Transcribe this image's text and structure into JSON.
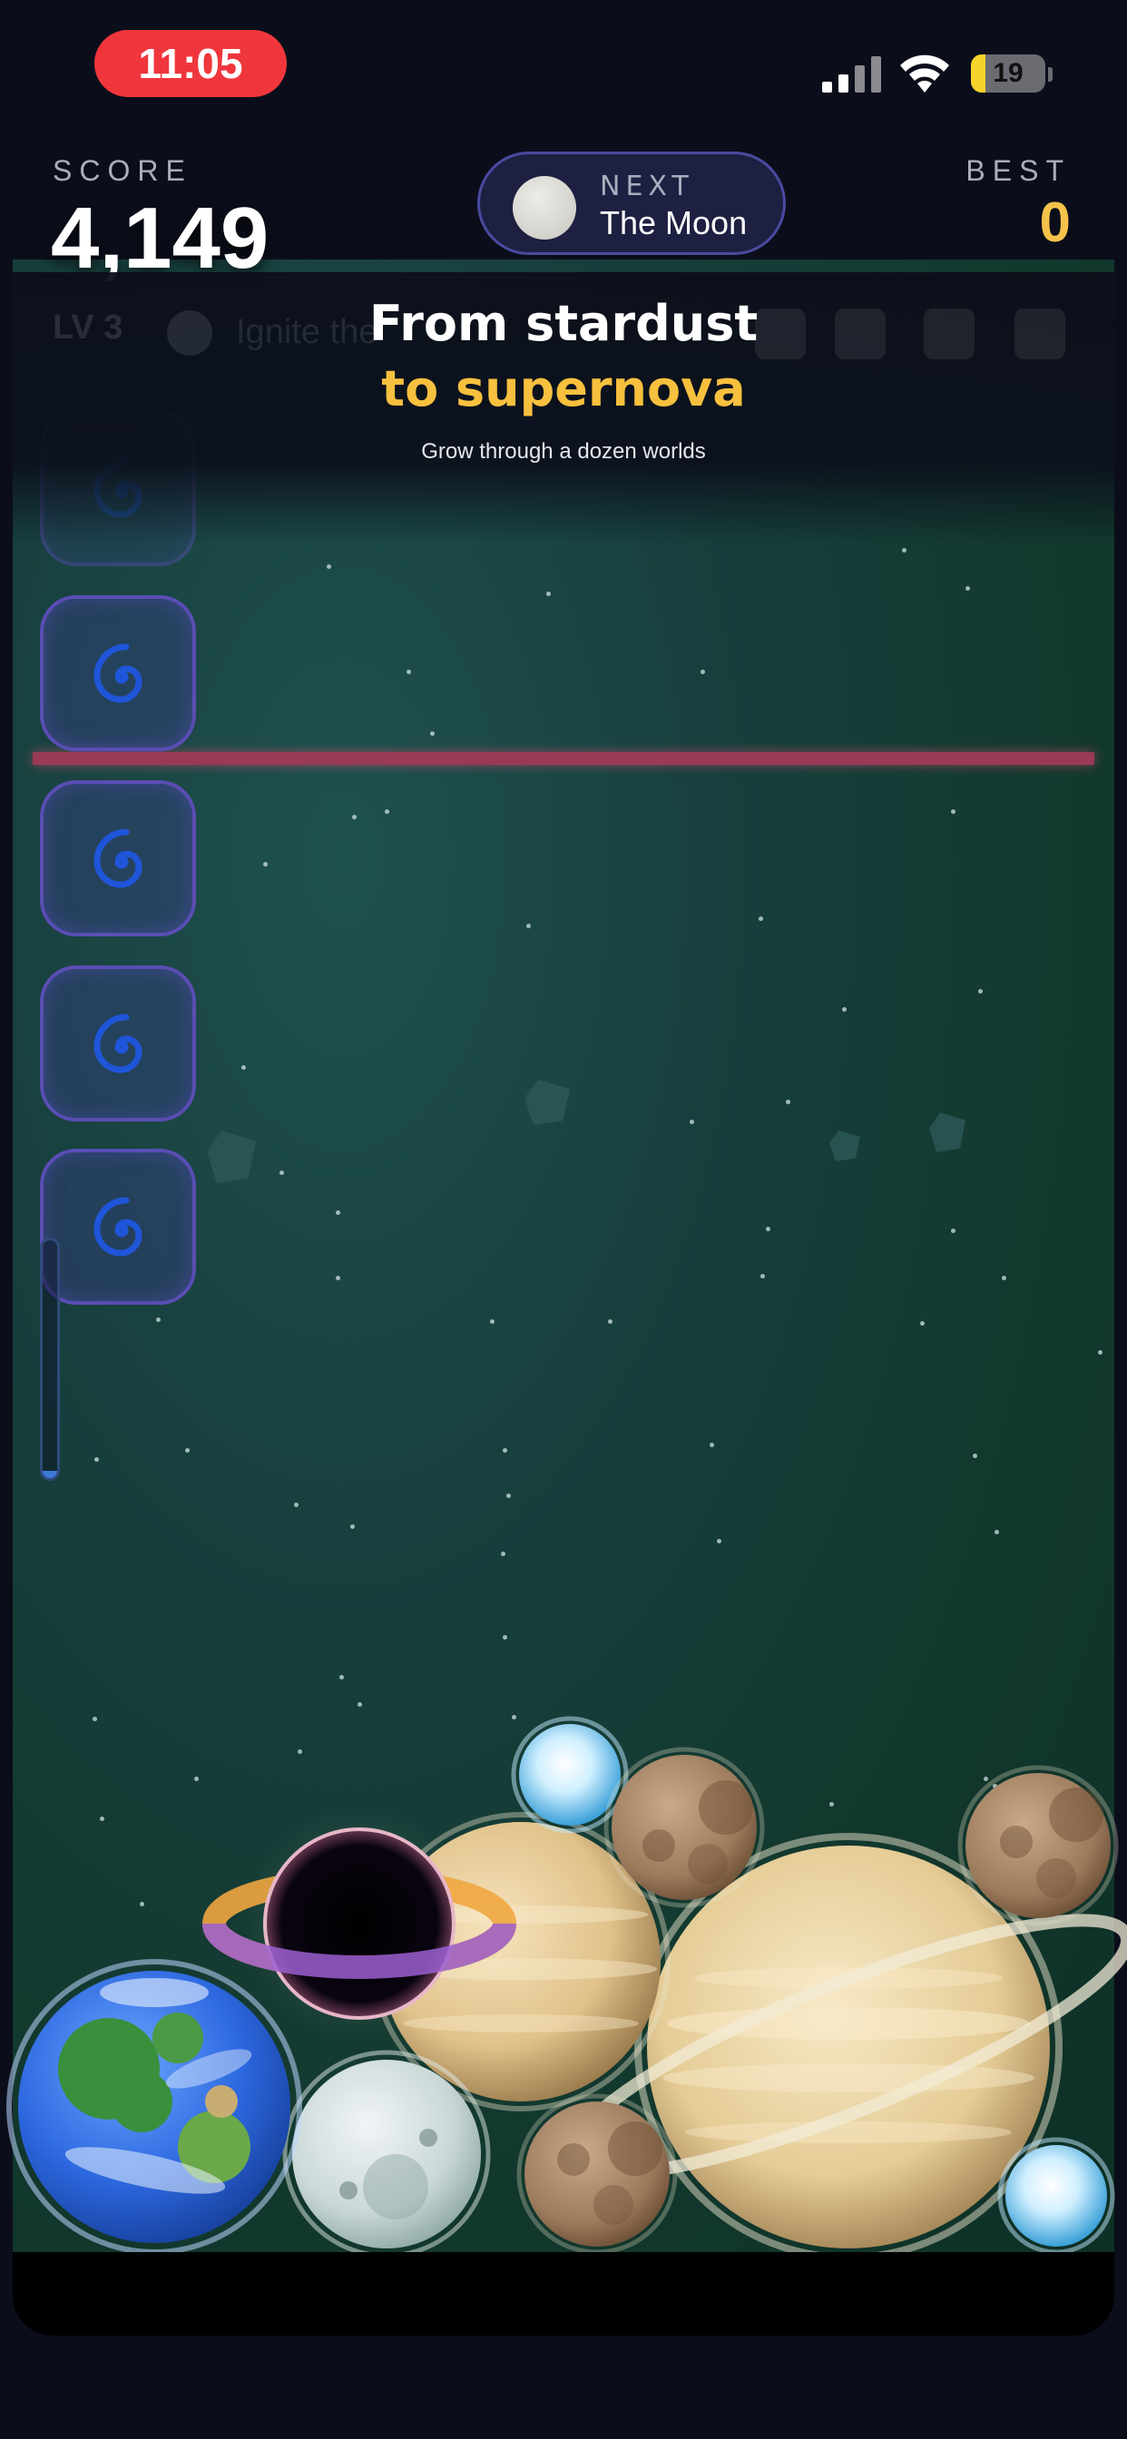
{
  "status_bar": {
    "time": "11:05",
    "battery": "19",
    "battery_level": 0.19
  },
  "header": {
    "score_label": "SCORE",
    "score": "4,149",
    "best_label": "BEST",
    "best": "0",
    "next_label": "NEXT",
    "next_name": "The Moon"
  },
  "toolbar": {
    "level": "LV 3",
    "hint": "Ignite the"
  },
  "overlay": {
    "title_line1": "From stardust",
    "title_line2": "to supernova",
    "subtitle": "Grow through a dozen worlds"
  },
  "queue": {
    "items": [
      "galaxy",
      "galaxy",
      "galaxy",
      "galaxy",
      "galaxy"
    ]
  },
  "power": {
    "level": 0.03
  },
  "board": {
    "bodies": [
      "earth",
      "comet",
      "black-hole",
      "jupiter",
      "moon",
      "mars",
      "mars",
      "saturn",
      "mars",
      "comet"
    ]
  },
  "colors": {
    "accent": "#f7c03e",
    "danger_line": "#9a3a56",
    "time_pill": "#f0363d",
    "slot_border": "#5a4db4"
  }
}
